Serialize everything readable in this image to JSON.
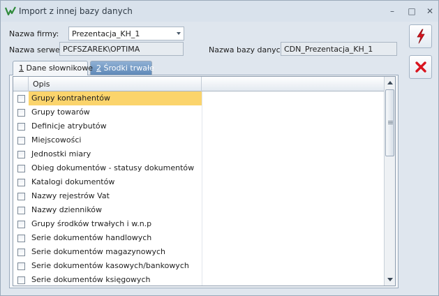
{
  "window": {
    "title": "Import z innej bazy danych",
    "app_icon": "optima-logo-icon",
    "controls": {
      "minimize": "–",
      "maximize": "□",
      "close": "✕"
    }
  },
  "form": {
    "company_label": "Nazwa firmy:",
    "company_value": "Prezentacja_KH_1",
    "server_label": "Nazwa serwera:",
    "server_value": "PCFSZAREK\\OPTIMA",
    "database_label": "Nazwa bazy danych:",
    "database_value": "CDN_Prezentacja_KH_1"
  },
  "tabs": [
    {
      "key": "1",
      "label": " Dane słownikowe",
      "active": true
    },
    {
      "key": "2",
      "label": " Środki trwałe",
      "active": false
    }
  ],
  "grid": {
    "column_header": "Opis",
    "rows": [
      {
        "label": "Grupy kontrahentów",
        "checked": false,
        "selected": true
      },
      {
        "label": "Grupy towarów",
        "checked": false,
        "selected": false
      },
      {
        "label": "Definicje atrybutów",
        "checked": false,
        "selected": false
      },
      {
        "label": "Miejscowości",
        "checked": false,
        "selected": false
      },
      {
        "label": "Jednostki miary",
        "checked": false,
        "selected": false
      },
      {
        "label": "Obieg dokumentów - statusy dokumentów",
        "checked": false,
        "selected": false
      },
      {
        "label": "Katalogi dokumentów",
        "checked": false,
        "selected": false
      },
      {
        "label": "Nazwy rejestrów Vat",
        "checked": false,
        "selected": false
      },
      {
        "label": "Nazwy dzienników",
        "checked": false,
        "selected": false
      },
      {
        "label": "Grupy środków trwałych i w.n.p",
        "checked": false,
        "selected": false
      },
      {
        "label": "Serie dokumentów handlowych",
        "checked": false,
        "selected": false
      },
      {
        "label": "Serie dokumentów magazynowych",
        "checked": false,
        "selected": false
      },
      {
        "label": "Serie dokumentów kasowych/bankowych",
        "checked": false,
        "selected": false
      },
      {
        "label": "Serie dokumentów księgowych",
        "checked": false,
        "selected": false
      }
    ]
  },
  "buttons": {
    "run_icon": "lightning-icon",
    "cancel_icon": "red-x-icon"
  },
  "colors": {
    "selected_row": "#fbd46c",
    "inactive_tab": "#6f96c3",
    "accent_red": "#d9141e"
  }
}
